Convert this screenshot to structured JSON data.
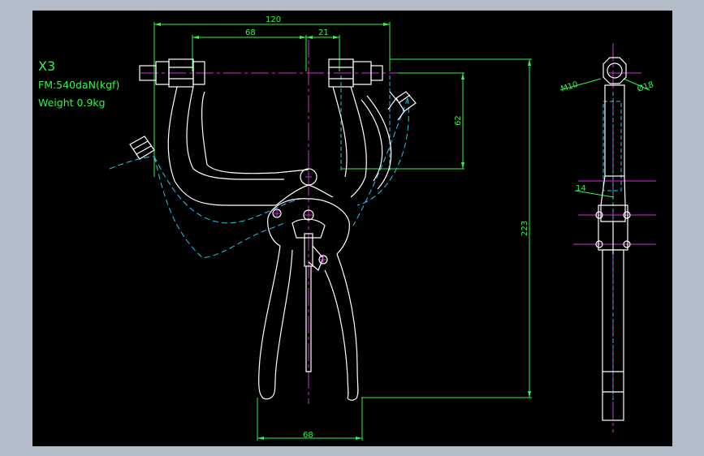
{
  "drawing": {
    "part_name": "X3",
    "force_note": "FM:540daN(kgf)",
    "weight_note": "Weight 0.9kg"
  },
  "dimensions": {
    "overall_width": "120",
    "inner_width": "68",
    "offset": "21",
    "vertical_short": "62",
    "overall_height": "223",
    "bottom_width": "68",
    "side_m10": "M10",
    "side_dia": "Ø18",
    "side_14": "14"
  },
  "colors": {
    "background": "#000000",
    "outline": "#ffffff",
    "dimension": "#31f34a",
    "centerline": "#d52bd5",
    "hidden": "#27c6e8",
    "frame": "#b3bcc9"
  }
}
